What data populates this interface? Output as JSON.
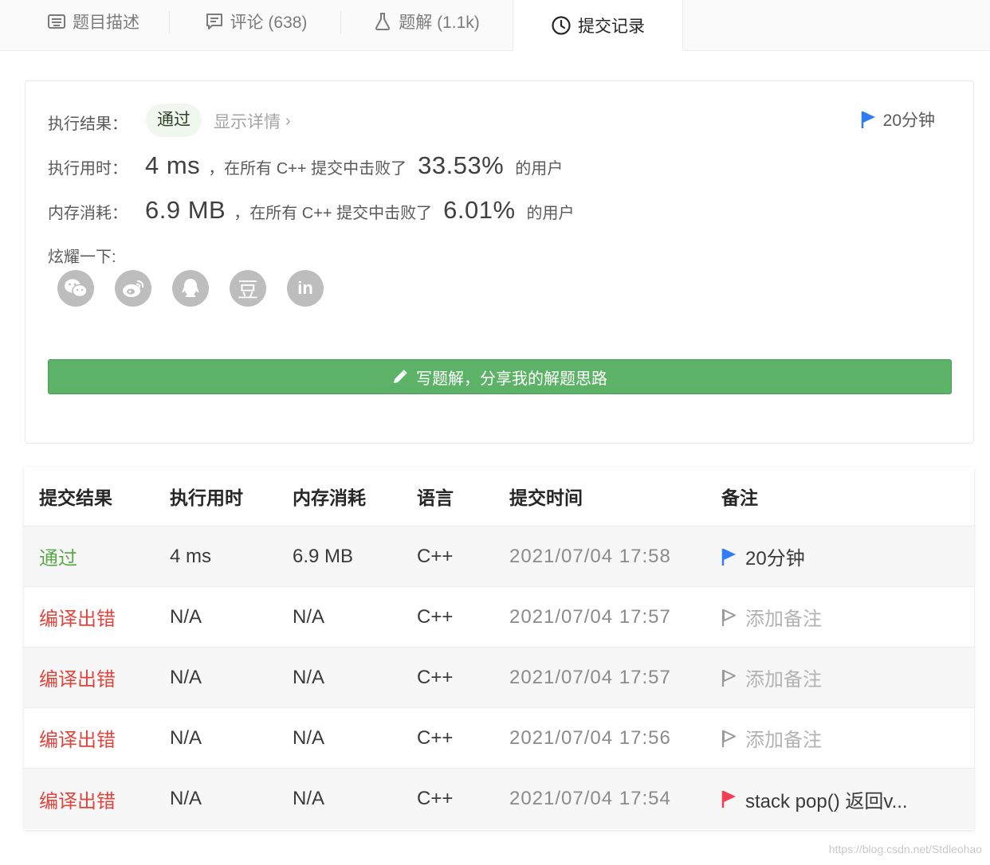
{
  "tabs": [
    {
      "label": "题目描述",
      "icon": "description-icon"
    },
    {
      "label": "评论 (638)",
      "icon": "comment-icon"
    },
    {
      "label": "题解 (1.1k)",
      "icon": "flask-icon"
    },
    {
      "label": "提交记录",
      "icon": "clock-icon",
      "active": true
    }
  ],
  "result": {
    "result_label": "执行结果：",
    "status": "通过",
    "details_link": "显示详情",
    "note": "20分钟",
    "runtime_label": "执行用时：",
    "runtime_value": "4 ms",
    "runtime_text": "，在所有 C++ 提交中击败了",
    "runtime_percent": "33.53%",
    "runtime_suffix": "的用户",
    "memory_label": "内存消耗：",
    "memory_value": "6.9 MB",
    "memory_text": "，在所有 C++ 提交中击败了",
    "memory_percent": "6.01%",
    "memory_suffix": "的用户",
    "share_label": "炫耀一下:",
    "share_icons": [
      "wechat-icon",
      "weibo-icon",
      "qq-icon",
      "douban-icon",
      "linkedin-icon"
    ],
    "douban_glyph": "豆",
    "linkedin_glyph": "in",
    "solution_button": "写题解，分享我的解题思路"
  },
  "table": {
    "headers": [
      "提交结果",
      "执行用时",
      "内存消耗",
      "语言",
      "提交时间",
      "备注"
    ],
    "rows": [
      {
        "status": "通过",
        "runtime": "4 ms",
        "memory": "6.9 MB",
        "lang": "C++",
        "time": "2021/07/04 17:58",
        "note": "20分钟",
        "flag": "blue"
      },
      {
        "status": "编译出错",
        "runtime": "N/A",
        "memory": "N/A",
        "lang": "C++",
        "time": "2021/07/04 17:57",
        "note": "添加备注",
        "flag": "outline"
      },
      {
        "status": "编译出错",
        "runtime": "N/A",
        "memory": "N/A",
        "lang": "C++",
        "time": "2021/07/04 17:57",
        "note": "添加备注",
        "flag": "outline"
      },
      {
        "status": "编译出错",
        "runtime": "N/A",
        "memory": "N/A",
        "lang": "C++",
        "time": "2021/07/04 17:56",
        "note": "添加备注",
        "flag": "outline"
      },
      {
        "status": "编译出错",
        "runtime": "N/A",
        "memory": "N/A",
        "lang": "C++",
        "time": "2021/07/04 17:54",
        "note": "stack pop() 返回v...",
        "flag": "red"
      }
    ]
  },
  "colors": {
    "pass": "#5ba94a",
    "error": "#e0453d",
    "flag_blue": "#2f7cf6",
    "flag_red": "#f03e55",
    "button": "#5cb367"
  },
  "watermark": "https://blog.csdn.net/Stdleohao"
}
